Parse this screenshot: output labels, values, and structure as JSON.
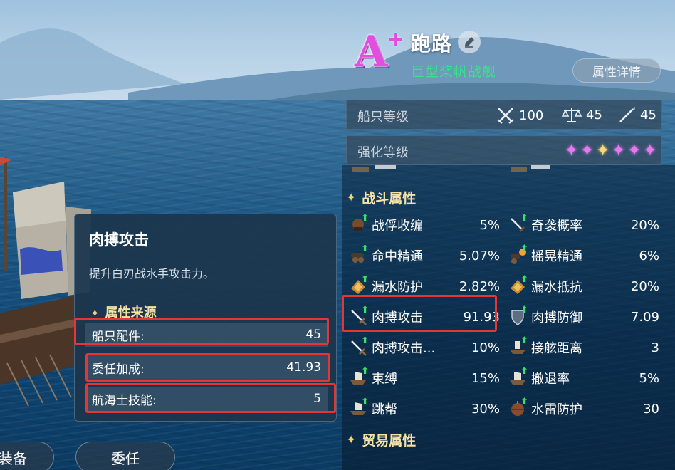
{
  "ship": {
    "grade_letter": "A",
    "grade_plus": "+",
    "name": "跑路",
    "type": "巨型桨帆战舰",
    "detail_button": "属性详情"
  },
  "levels": {
    "ship_level_label": "船只等级",
    "ship_level_values": {
      "attack": "100",
      "balance": "45",
      "sail": "45"
    },
    "enhance_label": "强化等级",
    "enhance_stars": [
      {
        "glyph": "✦",
        "color": "#e878f0"
      },
      {
        "glyph": "✦",
        "color": "#e878f0"
      },
      {
        "glyph": "✦",
        "color": "#f6d87a"
      },
      {
        "glyph": "✦",
        "color": "#e878f0"
      },
      {
        "glyph": "✦",
        "color": "#e878f0"
      },
      {
        "glyph": "✦",
        "color": "#e878f0"
      }
    ]
  },
  "battle": {
    "title": "战斗属性",
    "stats": [
      {
        "name": "战俘收编",
        "value": "5%",
        "icon": "captive-icon"
      },
      {
        "name": "奇袭概率",
        "value": "20%",
        "icon": "dagger-icon"
      },
      {
        "name": "命中精通",
        "value": "5.07%",
        "icon": "cannon-icon"
      },
      {
        "name": "摇晃精通",
        "value": "6%",
        "icon": "cannon-fire-icon"
      },
      {
        "name": "漏水防护",
        "value": "2.82%",
        "icon": "hull-icon"
      },
      {
        "name": "漏水抵抗",
        "value": "20%",
        "icon": "hull-icon"
      },
      {
        "name": "肉搏攻击",
        "value": "91.93",
        "icon": "sword-icon"
      },
      {
        "name": "肉搏防御",
        "value": "7.09",
        "icon": "shield-icon"
      },
      {
        "name": "肉搏攻击...",
        "value": "10%",
        "icon": "sword-icon"
      },
      {
        "name": "接舷距离",
        "value": "3",
        "icon": "boarding-ship-icon"
      },
      {
        "name": "束缚",
        "value": "15%",
        "icon": "ship-icon"
      },
      {
        "name": "撤退率",
        "value": "5%",
        "icon": "ship-icon"
      },
      {
        "name": "跳帮",
        "value": "30%",
        "icon": "ship-icon"
      },
      {
        "name": "水雷防护",
        "value": "30",
        "icon": "mine-icon"
      }
    ]
  },
  "trade": {
    "title": "贸易属性"
  },
  "tooltip": {
    "title": "肉搏攻击",
    "description": "提升白刃战水手攻击力。",
    "section_title": "属性来源",
    "rows": [
      {
        "label": "船只配件:",
        "value": "45"
      },
      {
        "label": "委任加成:",
        "value": "41.93"
      },
      {
        "label": "航海士技能:",
        "value": "5"
      }
    ]
  },
  "bottom": {
    "equip_label": "装备",
    "appoint_label": "委任"
  },
  "colors": {
    "grade": "#e14ee0",
    "ship_type": "#39e28a",
    "section_title": "#f6e2a6",
    "highlight": "#e53535",
    "stat_up": "#3ddf6a"
  }
}
